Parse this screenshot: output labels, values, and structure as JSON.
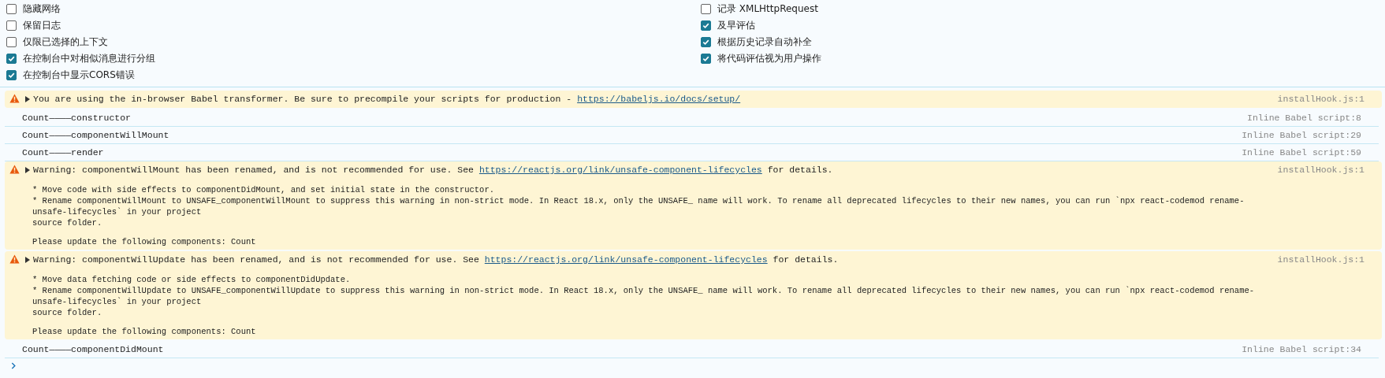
{
  "settings": [
    {
      "label": "隐藏网络",
      "checked": false
    },
    {
      "label": "记录 XMLHttpRequest",
      "checked": false
    },
    {
      "label": "保留日志",
      "checked": false
    },
    {
      "label": "及早评估",
      "checked": true
    },
    {
      "label": "仅限已选择的上下文",
      "checked": false
    },
    {
      "label": "根据历史记录自动补全",
      "checked": true
    },
    {
      "label": "在控制台中对相似消息进行分组",
      "checked": true
    },
    {
      "label": "将代码评估视为用户操作",
      "checked": true
    },
    {
      "label": "在控制台中显示CORS错误",
      "checked": true
    }
  ],
  "messages": [
    {
      "kind": "warning",
      "text": "You are using the in-browser Babel transformer. Be sure to precompile your scripts for production - ",
      "link": "https://babeljs.io/docs/setup/",
      "source": "installHook.js:1"
    },
    {
      "kind": "log",
      "text": "Count————constructor",
      "source": "Inline Babel script:8"
    },
    {
      "kind": "log",
      "text": "Count————componentWillMount",
      "source": "Inline Babel script:29"
    },
    {
      "kind": "log",
      "text": "Count————render",
      "source": "Inline Babel script:59"
    },
    {
      "kind": "warning",
      "text": "Warning: componentWillMount has been renamed, and is not recommended for use. See ",
      "link": "https://reactjs.org/link/unsafe-component-lifecycles",
      "after": " for details.",
      "source": "installHook.js:1",
      "details": [
        [
          "* Move code with side effects to componentDidMount, and set initial state in the constructor.",
          "* Rename componentWillMount to UNSAFE_componentWillMount to suppress this warning in non-strict mode. In React 18.x, only the UNSAFE_ name will work. To rename all deprecated lifecycles to their new names, you can run `npx react-codemod rename-unsafe-lifecycles` in your project",
          "source folder."
        ],
        [
          "Please update the following components: Count"
        ]
      ]
    },
    {
      "kind": "warning",
      "text": "Warning: componentWillUpdate has been renamed, and is not recommended for use. See ",
      "link": "https://reactjs.org/link/unsafe-component-lifecycles",
      "after": " for details.",
      "source": "installHook.js:1",
      "details": [
        [
          "* Move data fetching code or side effects to componentDidUpdate.",
          "* Rename componentWillUpdate to UNSAFE_componentWillUpdate to suppress this warning in non-strict mode. In React 18.x, only the UNSAFE_ name will work. To rename all deprecated lifecycles to their new names, you can run `npx react-codemod rename-unsafe-lifecycles` in your project",
          "source folder."
        ],
        [
          "Please update the following components: Count"
        ]
      ]
    },
    {
      "kind": "log",
      "text": "Count————componentDidMount",
      "source": "Inline Babel script:34"
    }
  ]
}
